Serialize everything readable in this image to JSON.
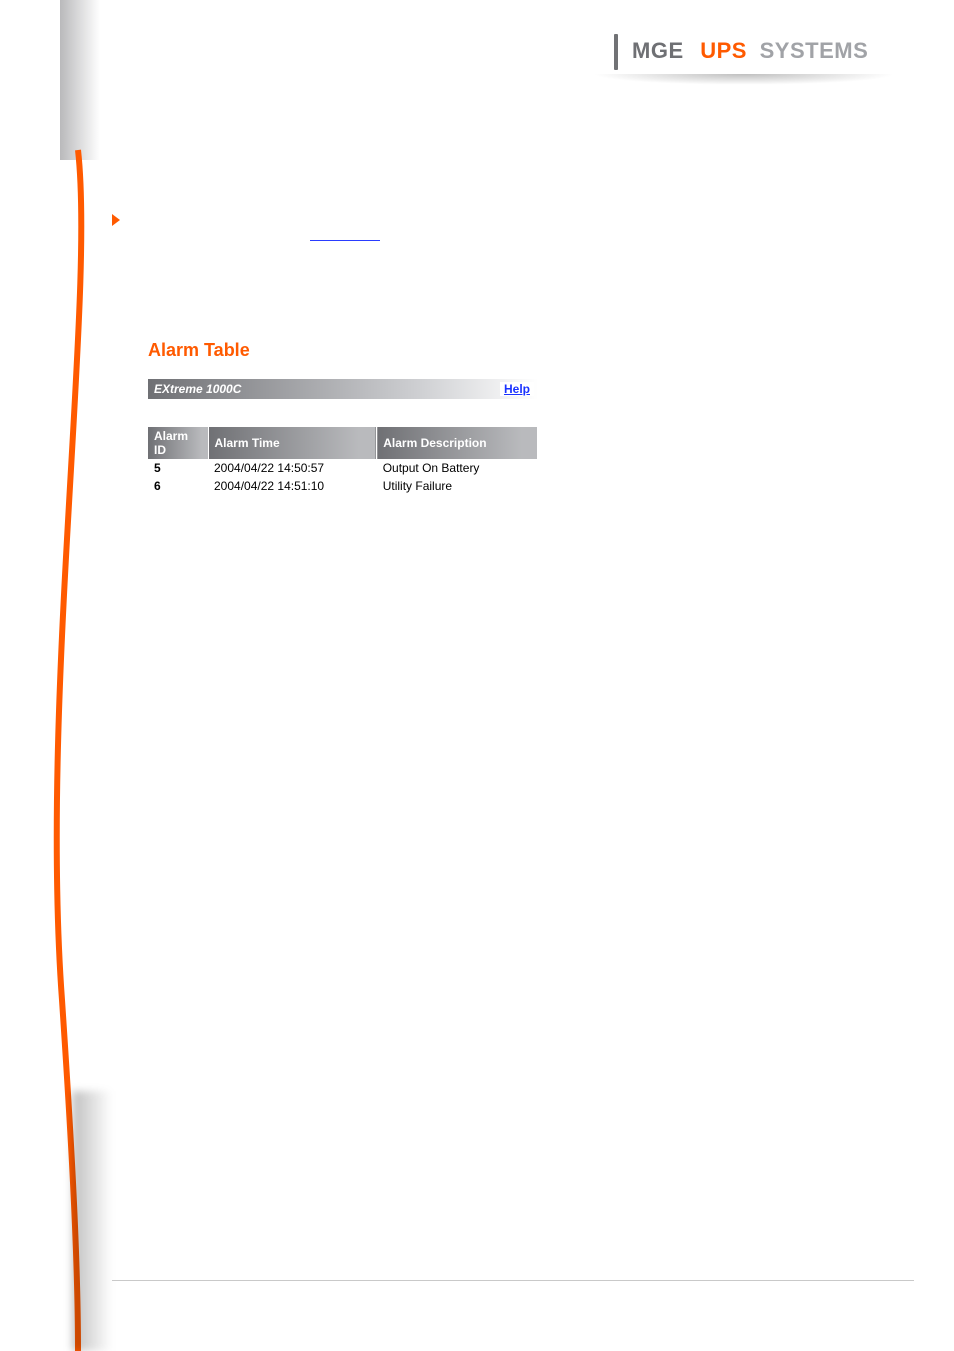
{
  "brand": {
    "part1": "MGE",
    "part2": "UPS",
    "part3": "SYSTEMS"
  },
  "bulletLabel": "",
  "inlineLink": "",
  "panel": {
    "title": "Alarm Table",
    "deviceName": "EXtreme 1000C",
    "helpLabel": "Help",
    "columns": {
      "id": "Alarm ID",
      "time": "Alarm Time",
      "desc": "Alarm Description"
    },
    "rows": [
      {
        "id": "5",
        "time": "2004/04/22 14:50:57",
        "desc": "Output On Battery"
      },
      {
        "id": "6",
        "time": "2004/04/22 14:51:10",
        "desc": "Utility Failure"
      }
    ]
  }
}
